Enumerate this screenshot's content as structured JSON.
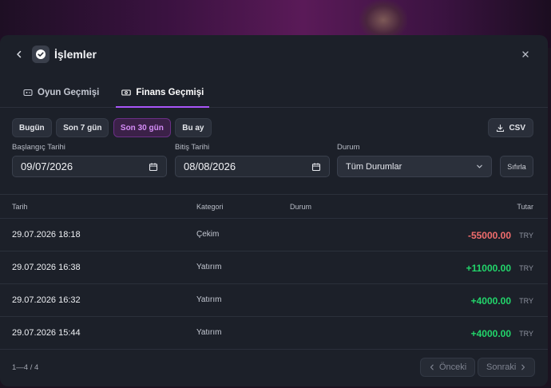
{
  "modal": {
    "title": "İşlemler"
  },
  "tabs": [
    {
      "label": "Oyun Geçmişi",
      "icon": "gamepad-icon",
      "active": false
    },
    {
      "label": "Finans Geçmişi",
      "icon": "money-icon",
      "active": true
    }
  ],
  "filters": {
    "ranges": [
      {
        "label": "Bugün",
        "active": false
      },
      {
        "label": "Son 7 gün",
        "active": false
      },
      {
        "label": "Son 30 gün",
        "active": true
      },
      {
        "label": "Bu ay",
        "active": false
      }
    ],
    "csv_label": "CSV",
    "start": {
      "label": "Başlangıç Tarihi",
      "value": "09/07/2026"
    },
    "end": {
      "label": "Bitiş Tarihi",
      "value": "08/08/2026"
    },
    "status": {
      "label": "Durum",
      "value": "Tüm Durumlar"
    },
    "reset_label": "Sıfırla"
  },
  "table": {
    "headers": {
      "date": "Tarih",
      "category": "Kategori",
      "status": "Durum",
      "amount": "Tutar"
    },
    "rows": [
      {
        "date": "29.07.2026 18:18",
        "category": "Çekim",
        "status": "",
        "amount": "-55000.00",
        "currency": "TRY"
      },
      {
        "date": "29.07.2026 16:38",
        "category": "Yatırım",
        "status": "",
        "amount": "+11000.00",
        "currency": "TRY"
      },
      {
        "date": "29.07.2026 16:32",
        "category": "Yatırım",
        "status": "",
        "amount": "+4000.00",
        "currency": "TRY"
      },
      {
        "date": "29.07.2026 15:44",
        "category": "Yatırım",
        "status": "",
        "amount": "+4000.00",
        "currency": "TRY"
      }
    ]
  },
  "pagination": {
    "info": "1—4 / 4",
    "prev_label": "Önceki",
    "next_label": "Sonraki"
  },
  "colors": {
    "accent": "#a855f7",
    "negative": "#f26d6d",
    "positive": "#22d66b",
    "panel": "#1c2029"
  }
}
